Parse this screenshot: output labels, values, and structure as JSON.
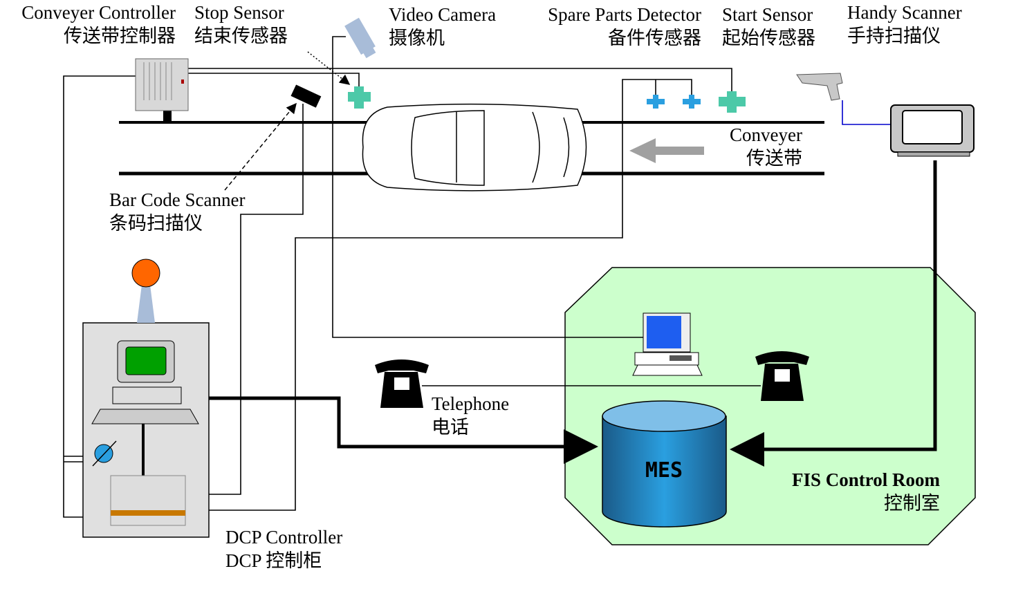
{
  "labels": {
    "conveyer_controller": {
      "en": "Conveyer Controller",
      "zh": "传送带控制器"
    },
    "stop_sensor": {
      "en": "Stop Sensor",
      "zh": "结束传感器"
    },
    "video_camera": {
      "en": "Video Camera",
      "zh": "摄像机"
    },
    "spare_parts_detector": {
      "en": "Spare Parts Detector",
      "zh": "备件传感器"
    },
    "start_sensor": {
      "en": "Start Sensor",
      "zh": "起始传感器"
    },
    "handy_scanner": {
      "en": "Handy Scanner",
      "zh": "手持扫描仪"
    },
    "conveyer": {
      "en": "Conveyer",
      "zh": "传送带"
    },
    "bar_code_scanner": {
      "en": "Bar Code Scanner",
      "zh": "条码扫描仪"
    },
    "telephone": {
      "en": "Telephone",
      "zh": "电话"
    },
    "dcp_controller": {
      "en": "DCP Controller",
      "zh": "DCP 控制柜"
    },
    "fis_control_room": {
      "en": "FIS Control Room",
      "zh": "控制室"
    },
    "database": "MES"
  },
  "colors": {
    "control_room_fill": "#ccffcc",
    "sensor_green": "#4cc9a8",
    "sensor_blue": "#2a9fe0",
    "beacon": "#ff6600",
    "database": "#2a8fd0",
    "cabinet": "#e0e0e0"
  }
}
